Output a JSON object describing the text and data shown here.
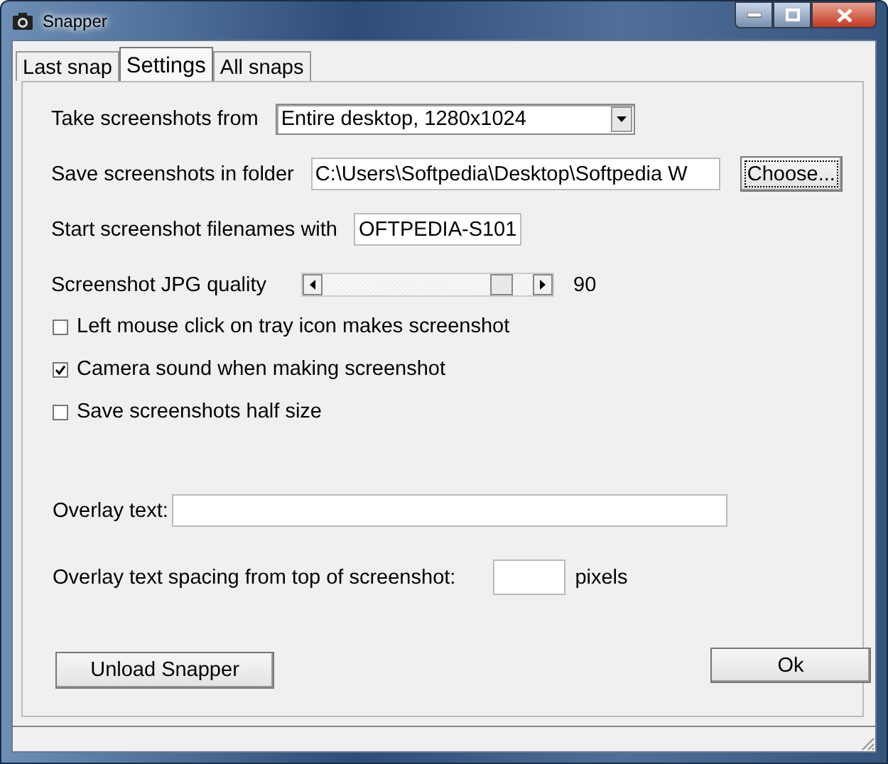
{
  "window": {
    "title": "Snapper"
  },
  "tabs": [
    {
      "label": "Last snap",
      "selected": false
    },
    {
      "label": "Settings",
      "selected": true
    },
    {
      "label": "All snaps",
      "selected": false
    }
  ],
  "source": {
    "label": "Take screenshots from",
    "value": "Entire desktop, 1280x1024"
  },
  "folder": {
    "label": "Save screenshots in folder",
    "value": "C:\\Users\\Softpedia\\Desktop\\Softpedia W",
    "button": "Choose..."
  },
  "prefix": {
    "label": "Start screenshot filenames with",
    "value": "OFTPEDIA-S101"
  },
  "quality": {
    "label": "Screenshot JPG quality",
    "level": 0.9,
    "reading": "90"
  },
  "options": [
    {
      "label": "Left mouse click on tray icon makes screenshot",
      "checked": false
    },
    {
      "label": "Camera sound when making screenshot",
      "checked": true
    },
    {
      "label": "Save screenshots half size",
      "checked": false
    }
  ],
  "overlay": {
    "label": "Overlay text:"
  },
  "spacing": {
    "label": "Overlay text spacing from top of screenshot:",
    "unit": "pixels"
  },
  "buttons": {
    "unload": "Unload Snapper",
    "ok": "Ok"
  }
}
